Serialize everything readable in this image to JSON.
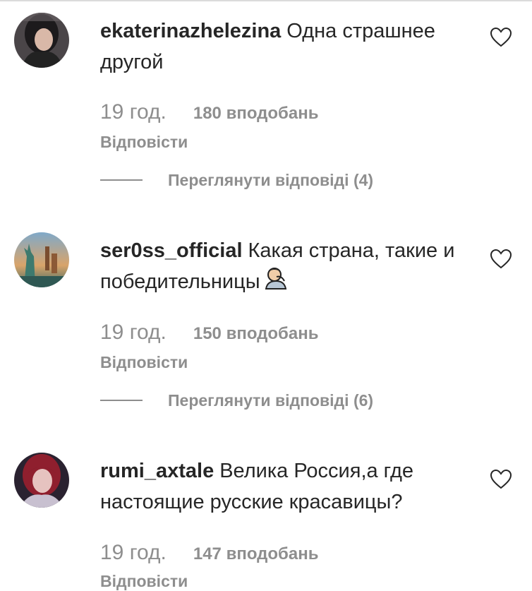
{
  "comments": [
    {
      "username": "ekaterinazhelezina",
      "text": "Одна страшнее другой",
      "time": "19 год.",
      "likes": "180 вподобань",
      "reply": "Відповісти",
      "view_replies": "Переглянути відповіді (4)",
      "avatar_icon": "avatar-photo-dark-hair",
      "like_icon": "heart-outline-icon"
    },
    {
      "username": "ser0ss_official",
      "text": "Какая страна, такие и победительницы",
      "emoji": "facepalm-emoji",
      "time": "19 год.",
      "likes": "150 вподобань",
      "reply": "Відповісти",
      "view_replies": "Переглянути відповіді (6)",
      "avatar_icon": "avatar-photo-statue-of-liberty",
      "like_icon": "heart-outline-icon"
    },
    {
      "username": "rumi_axtale",
      "text": "Велика Россия,а где настоящие русские красавицы?",
      "time": "19 год.",
      "likes": "147 вподобань",
      "reply": "Відповісти",
      "avatar_icon": "avatar-photo-red-hair",
      "like_icon": "heart-outline-icon"
    }
  ],
  "colors": {
    "text": "#262626",
    "secondary": "#8e8e8e",
    "divider": "#dbdbdb"
  }
}
